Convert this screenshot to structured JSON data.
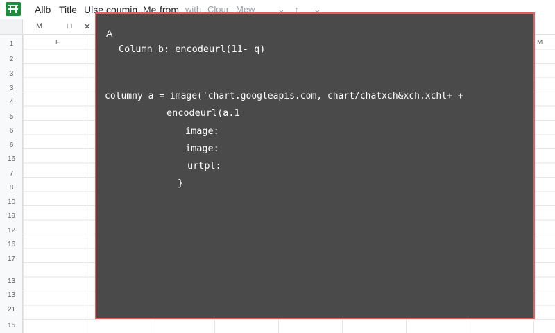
{
  "menu": {
    "items": [
      "Allb",
      "Title",
      "Ulse",
      "coumin",
      "Me.",
      "from",
      "with",
      "Clour",
      "Mew"
    ],
    "icons": [
      "chevron-down-icon",
      "arrow-up-icon",
      "chevron-down-icon"
    ]
  },
  "toolbar": {
    "cell_ref": "M",
    "fx_label": "F",
    "col_letter_left": "F",
    "col_letter_right": "M"
  },
  "row_numbers": [
    "1",
    "2",
    "3",
    "3",
    "4",
    "5",
    "6",
    "6",
    "16",
    "7",
    "8",
    "10",
    "19",
    "12",
    "16",
    "17",
    "13",
    "13",
    "21",
    "15"
  ],
  "panel": {
    "heading": "A",
    "lines": [
      "Column b: encodeurl(11- q)",
      "columny a = image('chart.googleapis.com, chart/chatxch&xch.xchl+ +",
      "encodeurl(a.1",
      "image:",
      "image:",
      "urtpl:",
      "}"
    ]
  },
  "colors": {
    "overlay_bg": "#4a4a4a",
    "overlay_border": "#e35d5d",
    "brand": "#1e8e3e"
  }
}
